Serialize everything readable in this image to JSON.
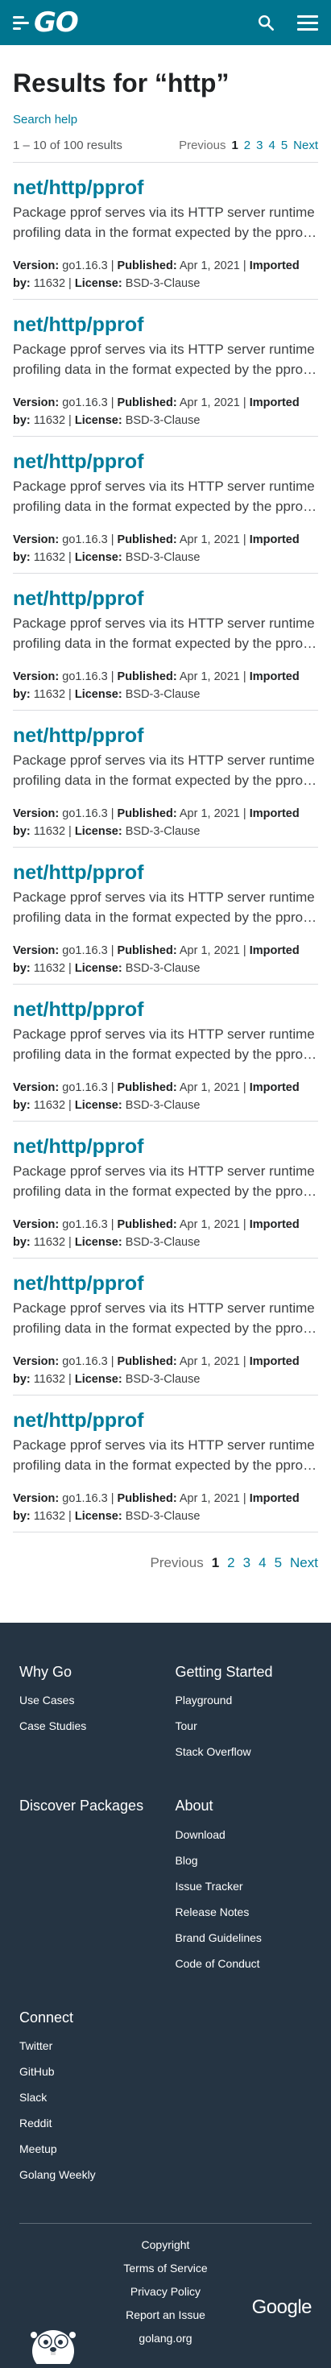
{
  "header": {
    "logo_text": "GO",
    "search_icon": "search-icon",
    "menu_icon": "hamburger-menu-icon",
    "brand_color": "#00758f"
  },
  "search": {
    "results_title": "Results for “http”",
    "help_link": "Search help",
    "summary": "1 – 10 of 100 results"
  },
  "pager": {
    "previous": "Previous",
    "pages": [
      "1",
      "2",
      "3",
      "4",
      "5"
    ],
    "current_page": "1",
    "next": "Next"
  },
  "results": [
    {
      "title": "net/http/pprof",
      "description": "Package pprof serves via its HTTP server runtime profiling data in the format expected by the pprof visualization tool.",
      "version_label": "Version:",
      "version": "go1.16.3",
      "published_label": "Published:",
      "published": "Apr 1, 2021",
      "imported_label": "Imported by:",
      "imported_by": "11632",
      "license_label": "License:",
      "license": "BSD-3-Clause"
    },
    {
      "title": "net/http/pprof",
      "description": "Package pprof serves via its HTTP server runtime profiling data in the format expected by the pprof visualization tool.",
      "version_label": "Version:",
      "version": "go1.16.3",
      "published_label": "Published:",
      "published": "Apr 1, 2021",
      "imported_label": "Imported by:",
      "imported_by": "11632",
      "license_label": "License:",
      "license": "BSD-3-Clause"
    },
    {
      "title": "net/http/pprof",
      "description": "Package pprof serves via its HTTP server runtime profiling data in the format expected by the pprof visualization tool.",
      "version_label": "Version:",
      "version": "go1.16.3",
      "published_label": "Published:",
      "published": "Apr 1, 2021",
      "imported_label": "Imported by:",
      "imported_by": "11632",
      "license_label": "License:",
      "license": "BSD-3-Clause"
    },
    {
      "title": "net/http/pprof",
      "description": "Package pprof serves via its HTTP server runtime profiling data in the format expected by the pprof visualization tool.",
      "version_label": "Version:",
      "version": "go1.16.3",
      "published_label": "Published:",
      "published": "Apr 1, 2021",
      "imported_label": "Imported by:",
      "imported_by": "11632",
      "license_label": "License:",
      "license": "BSD-3-Clause"
    },
    {
      "title": "net/http/pprof",
      "description": "Package pprof serves via its HTTP server runtime profiling data in the format expected by the pprof visualization tool.",
      "version_label": "Version:",
      "version": "go1.16.3",
      "published_label": "Published:",
      "published": "Apr 1, 2021",
      "imported_label": "Imported by:",
      "imported_by": "11632",
      "license_label": "License:",
      "license": "BSD-3-Clause"
    },
    {
      "title": "net/http/pprof",
      "description": "Package pprof serves via its HTTP server runtime profiling data in the format expected by the pprof visualization tool.",
      "version_label": "Version:",
      "version": "go1.16.3",
      "published_label": "Published:",
      "published": "Apr 1, 2021",
      "imported_label": "Imported by:",
      "imported_by": "11632",
      "license_label": "License:",
      "license": "BSD-3-Clause"
    },
    {
      "title": "net/http/pprof",
      "description": "Package pprof serves via its HTTP server runtime profiling data in the format expected by the pprof visualization tool.",
      "version_label": "Version:",
      "version": "go1.16.3",
      "published_label": "Published:",
      "published": "Apr 1, 2021",
      "imported_label": "Imported by:",
      "imported_by": "11632",
      "license_label": "License:",
      "license": "BSD-3-Clause"
    },
    {
      "title": "net/http/pprof",
      "description": "Package pprof serves via its HTTP server runtime profiling data in the format expected by the pprof visualization tool.",
      "version_label": "Version:",
      "version": "go1.16.3",
      "published_label": "Published:",
      "published": "Apr 1, 2021",
      "imported_label": "Imported by:",
      "imported_by": "11632",
      "license_label": "License:",
      "license": "BSD-3-Clause"
    },
    {
      "title": "net/http/pprof",
      "description": "Package pprof serves via its HTTP server runtime profiling data in the format expected by the pprof visualization tool.",
      "version_label": "Version:",
      "version": "go1.16.3",
      "published_label": "Published:",
      "published": "Apr 1, 2021",
      "imported_label": "Imported by:",
      "imported_by": "11632",
      "license_label": "License:",
      "license": "BSD-3-Clause"
    },
    {
      "title": "net/http/pprof",
      "description": "Package pprof serves via its HTTP server runtime profiling data in the format expected by the pprof visualization tool.",
      "version_label": "Version:",
      "version": "go1.16.3",
      "published_label": "Published:",
      "published": "Apr 1, 2021",
      "imported_label": "Imported by:",
      "imported_by": "11632",
      "license_label": "License:",
      "license": "BSD-3-Clause"
    }
  ],
  "footer": {
    "background": "#253443",
    "columns": [
      {
        "heading": "Why Go",
        "links": [
          "Use Cases",
          "Case Studies"
        ]
      },
      {
        "heading": "Getting Started",
        "links": [
          "Playground",
          "Tour",
          "Stack Overflow"
        ]
      },
      {
        "heading": "Discover Packages",
        "links": []
      },
      {
        "heading": "About",
        "links": [
          "Download",
          "Blog",
          "Issue Tracker",
          "Release Notes",
          "Brand Guidelines",
          "Code of Conduct"
        ]
      },
      {
        "heading": "Connect",
        "links": [
          "Twitter",
          "GitHub",
          "Slack",
          "Reddit",
          "Meetup",
          "Golang Weekly"
        ]
      }
    ],
    "bottom_links": [
      "Copyright",
      "Terms of Service",
      "Privacy Policy",
      "Report an Issue",
      "golang.org"
    ],
    "google_logo": "Google",
    "gopher_icon": "gopher-mascot-icon"
  }
}
